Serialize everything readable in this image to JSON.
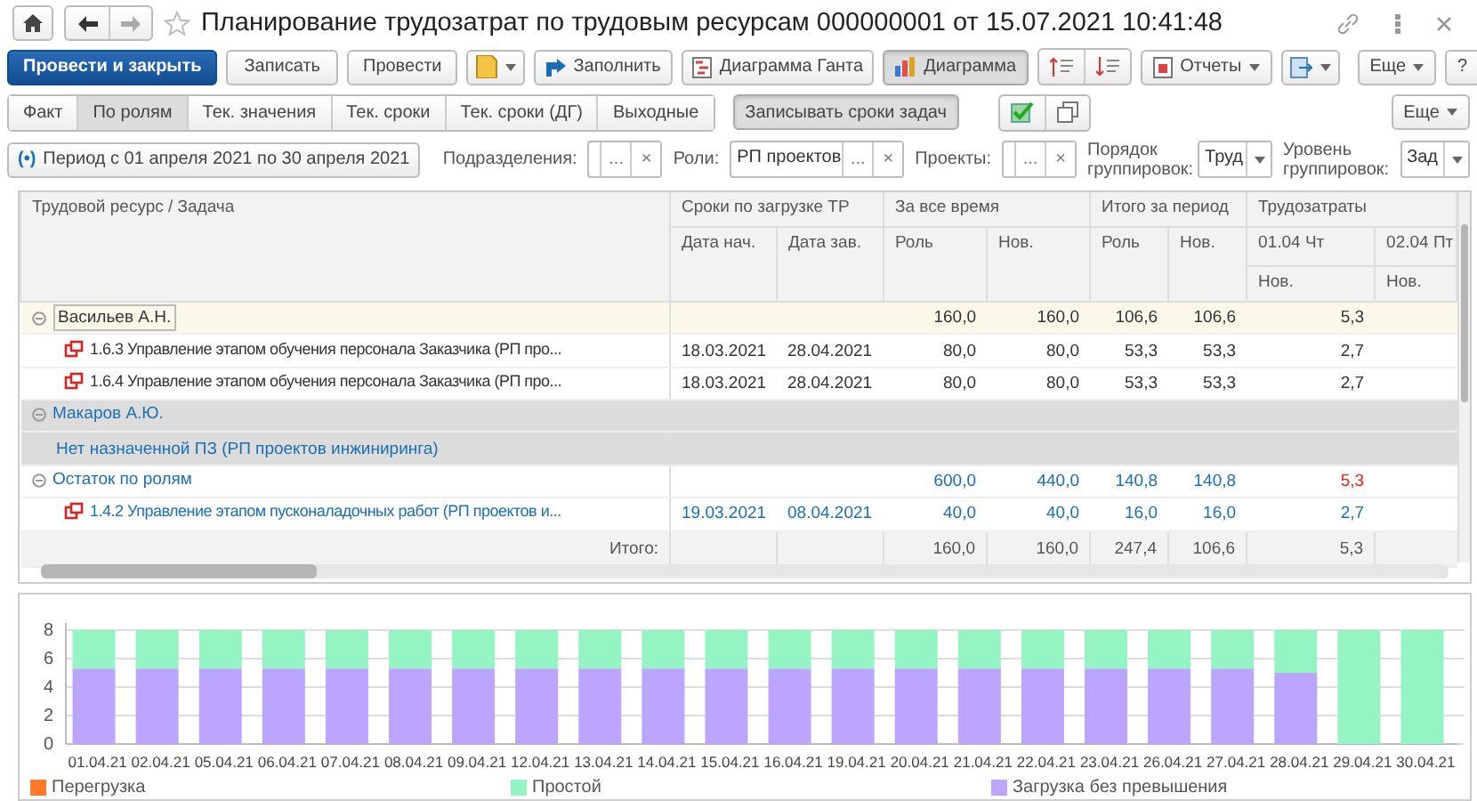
{
  "window": {
    "title": "Планирование трудозатрат по трудовым ресурсам 000000001 от 15.07.2021 10:41:48"
  },
  "toolbar": {
    "post_close": "Провести и закрыть",
    "save": "Записать",
    "post": "Провести",
    "fill": "Заполнить",
    "gantt": "Диаграмма Ганта",
    "chart": {
      "label": "Диаграмма",
      "selected": true
    },
    "reports": "Отчеты",
    "more": "Еще",
    "help": "?"
  },
  "view_tabs": [
    {
      "label": "Факт",
      "selected": false
    },
    {
      "label": "По ролям",
      "selected": true
    },
    {
      "label": "Тек. значения",
      "selected": false
    },
    {
      "label": "Тек. сроки",
      "selected": false
    },
    {
      "label": "Тек. сроки (ДГ)",
      "selected": false
    },
    {
      "label": "Выходные",
      "selected": false
    }
  ],
  "record_dates": {
    "label": "Записывать сроки задач",
    "selected": true
  },
  "more": "Еще",
  "period": {
    "icon": "(•)",
    "label": "Период с 01 апреля 2021 по 30 апреля 2021"
  },
  "filters": [
    {
      "label": "Подразделения:",
      "choose": "...",
      "clear": "×"
    },
    {
      "label": "Роли:",
      "value": "РП проектов",
      "choose": "...",
      "clear": "×"
    },
    {
      "label": "Проекты:",
      "choose": "...",
      "clear": "×"
    }
  ],
  "grouping": [
    {
      "label": "Порядок группировок:",
      "value": "Труд"
    },
    {
      "label": "Уровень группировок:",
      "value": "Зад"
    }
  ],
  "table": {
    "first_column": "Трудовой ресурс / Задача",
    "groups": [
      {
        "label": "Сроки по загрузке ТР",
        "columns": [
          {
            "label": "Дата нач."
          },
          {
            "label": "Дата зав."
          }
        ]
      },
      {
        "label": "За все время",
        "columns": [
          {
            "label": "Роль"
          },
          {
            "label": "Нов."
          }
        ]
      },
      {
        "label": "Итого за период",
        "columns": [
          {
            "label": "Роль"
          },
          {
            "label": "Нов."
          }
        ]
      },
      {
        "label": "Трудозатраты",
        "columns": [
          {
            "label": "01.04 Чт",
            "sub": "Нов."
          },
          {
            "label": "02.04 Пт",
            "sub": "Нов."
          }
        ]
      }
    ],
    "rows": [
      {
        "kind": "group",
        "label": "Васильев А.Н.",
        "expanded": true,
        "selected": true,
        "shaded": false,
        "color": "#333333",
        "overload": false,
        "cells": [
          null,
          null,
          "160,0",
          "160,0",
          "106,6",
          "106,6",
          "5,3",
          null
        ]
      },
      {
        "kind": "task",
        "label": "1.6.3 Управление этапом обучения персонала Заказчика (РП про...",
        "selected": false,
        "shaded": false,
        "color": "#333333",
        "overload": false,
        "cells": [
          "18.03.2021",
          "28.04.2021",
          "80,0",
          "80,0",
          "53,3",
          "53,3",
          "2,7",
          null
        ]
      },
      {
        "kind": "task",
        "label": "1.6.4 Управление этапом обучения персонала Заказчика (РП про...",
        "selected": false,
        "shaded": false,
        "color": "#333333",
        "overload": false,
        "cells": [
          "18.03.2021",
          "28.04.2021",
          "80,0",
          "80,0",
          "53,3",
          "53,3",
          "2,7",
          null
        ]
      },
      {
        "kind": "group",
        "label": "Макаров А.Ю.",
        "expanded": true,
        "selected": false,
        "shaded": true,
        "color": "#1a6fb4",
        "overload": false,
        "cells": []
      },
      {
        "kind": "note",
        "label": "Нет назначенной ПЗ (РП проектов инжиниринга)",
        "selected": false,
        "shaded": true,
        "color": "#1a6fb4",
        "overload": false,
        "cells": []
      },
      {
        "kind": "group",
        "label": "Остаток по ролям",
        "expanded": true,
        "selected": false,
        "shaded": false,
        "color": "#1a6fb4",
        "overload": true,
        "cells": [
          null,
          null,
          "600,0",
          "440,0",
          "140,8",
          "140,8",
          "5,3",
          null
        ]
      },
      {
        "kind": "task",
        "label": "1.4.2 Управление этапом пусконаладочных работ (РП проектов и...",
        "selected": false,
        "shaded": false,
        "color": "#1a6fb4",
        "overload": false,
        "cells": [
          "19.03.2021",
          "08.04.2021",
          "40,0",
          "40,0",
          "16,0",
          "16,0",
          "2,7",
          null
        ]
      }
    ],
    "footer": {
      "label": "Итого:",
      "cells": [
        null,
        null,
        "160,0",
        "160,0",
        "247,4",
        "106,6",
        "5,3",
        null
      ]
    }
  },
  "chart": {
    "chart_data": {
      "type": "bar",
      "stacked": true,
      "grid": true,
      "categories": [
        "01.04.21",
        "02.04.21",
        "05.04.21",
        "06.04.21",
        "07.04.21",
        "08.04.21",
        "09.04.21",
        "12.04.21",
        "13.04.21",
        "14.04.21",
        "15.04.21",
        "16.04.21",
        "19.04.21",
        "20.04.21",
        "21.04.21",
        "22.04.21",
        "23.04.21",
        "26.04.21",
        "27.04.21",
        "28.04.21",
        "29.04.21",
        "30.04.21"
      ],
      "ylim": [
        0,
        8
      ],
      "yticks": [
        0,
        2,
        4,
        6,
        8
      ],
      "series": [
        {
          "name": "Перегрузка",
          "color": "#ff7a2a",
          "values": [
            0,
            0,
            0,
            0,
            0,
            0,
            0,
            0,
            0,
            0,
            0,
            0,
            0,
            0,
            0,
            0,
            0,
            0,
            0,
            0,
            0,
            0
          ]
        },
        {
          "name": "Простой",
          "color": "#94f5c2",
          "values": [
            2.7,
            2.7,
            2.7,
            2.7,
            2.7,
            2.7,
            2.7,
            2.7,
            2.7,
            2.7,
            2.7,
            2.7,
            2.7,
            2.7,
            2.7,
            2.7,
            2.7,
            2.7,
            2.7,
            3.0,
            8,
            8
          ]
        },
        {
          "name": "Загрузка без превышения",
          "color": "#bca5ff",
          "values": [
            5.3,
            5.3,
            5.3,
            5.3,
            5.3,
            5.3,
            5.3,
            5.3,
            5.3,
            5.3,
            5.3,
            5.3,
            5.3,
            5.3,
            5.3,
            5.3,
            5.3,
            5.3,
            5.3,
            5.0,
            0,
            0
          ]
        }
      ]
    }
  }
}
